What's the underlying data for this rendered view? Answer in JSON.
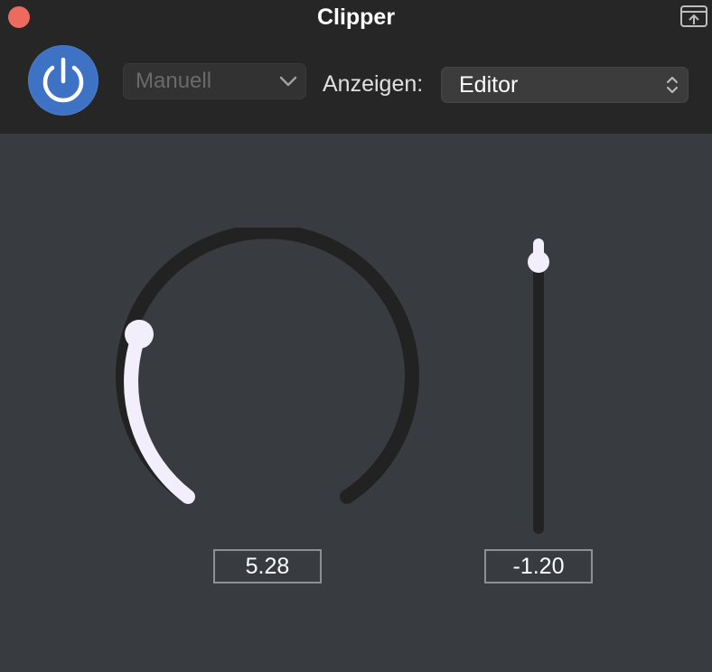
{
  "window": {
    "title": "Clipper",
    "close_color": "#ec6a5e"
  },
  "toolbar": {
    "power_state": "on",
    "power_color": "#3e72c4",
    "preset": "Manuell",
    "view_label": "Anzeigen:",
    "view_value": "Editor"
  },
  "controls": {
    "knob": {
      "value": "5.28",
      "level_fraction": 0.26
    },
    "slider": {
      "value": "-1.20",
      "level_fraction": 0.93
    }
  },
  "icons": [
    "close-icon",
    "view-toggle-icon",
    "power-icon",
    "chevron-down-icon",
    "chevron-updown-icon"
  ]
}
